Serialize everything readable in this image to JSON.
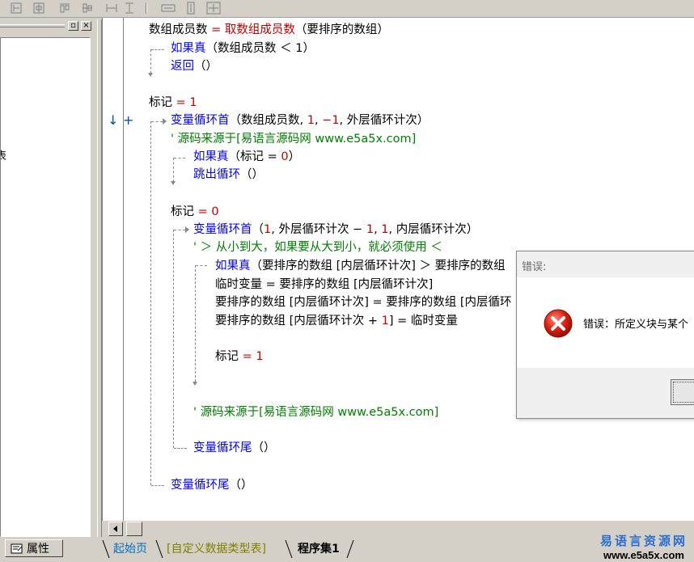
{
  "toolbar": {
    "buttons": [
      "align-left-icon",
      "align-center-icon",
      "align-top-icon",
      "align-middle-icon",
      "same-width-icon",
      "same-height-icon",
      "space-horizontal-icon",
      "space-vertical-icon",
      "center-both-icon"
    ]
  },
  "left_panel": {
    "partial_item": "表",
    "property_tab_label": "属性"
  },
  "code": {
    "l1": {
      "var": "数组成员数",
      "eq": " = ",
      "fn": "取数组成员数",
      "arg": "（要排序的数组）"
    },
    "l2": {
      "kw": "如果真",
      "arg": "（数组成员数 ＜ 1）"
    },
    "l3": {
      "kw": "返回",
      "arg": "（）"
    },
    "l4": {
      "var": "标记",
      "eq": " = ",
      "val": "1"
    },
    "l5": {
      "kw": "变量循环首",
      "arg": "（数组成员数, ",
      "n1": "1",
      "c1": ", ",
      "n2": "−1",
      "rest": ", 外层循环计次）"
    },
    "l6": {
      "comment": "' 源码来源于[易语言源码网 www.e5a5x.com]"
    },
    "l7": {
      "kw": "如果真",
      "arg": "（标记 = ",
      "val": "0",
      "end": "）"
    },
    "l8": {
      "kw": "跳出循环",
      "arg": "（）"
    },
    "l9": {
      "var": "标记",
      "eq": " = ",
      "val": "0"
    },
    "l10": {
      "kw": "变量循环首",
      "arg": "（",
      "n1": "1",
      "rest": ", 外层循环计次 − ",
      "n2": "1",
      "c": ", ",
      "n3": "1",
      "end": ", 内层循环计次）"
    },
    "l11": {
      "comment": "' ＞ 从小到大，如果要从大到小，就必须使用 ＜"
    },
    "l12": {
      "kw": "如果真",
      "arg": "（要排序的数组 [内层循环计次] ＞ 要排序的数组"
    },
    "l13": {
      "text": "临时变量 = 要排序的数组 [内层循环计次]"
    },
    "l14": {
      "text": "要排序的数组 [内层循环计次] = 要排序的数组 [内层循环"
    },
    "l15": {
      "pre": "要排序的数组 [内层循环计次 + ",
      "n": "1",
      "post": "] = 临时变量"
    },
    "l16": {
      "var": "标记",
      "eq": " = ",
      "val": "1"
    },
    "l17": {
      "comment": "' 源码来源于[易语言源码网 www.e5a5x.com]"
    },
    "l18": {
      "kw": "变量循环尾",
      "arg": "（）"
    },
    "l19": {
      "kw": "变量循环尾",
      "arg": "（）"
    }
  },
  "gutter": {
    "arrow": "↓",
    "plus": "+"
  },
  "tabs": {
    "start": "起始页",
    "custom": "[自定义数据类型表]",
    "program": "程序集1"
  },
  "dialog": {
    "title": "错误:",
    "message": "错误：所定义块与某个",
    "icon": "error-icon"
  },
  "watermark": {
    "top": "易语言资源网",
    "bottom": "www.e5a5x.com"
  },
  "colors": {
    "keyword": "#0000ff",
    "function": "#c00000",
    "comment": "#008000",
    "tab_start": "#0070c0",
    "tab_custom": "#808000"
  }
}
